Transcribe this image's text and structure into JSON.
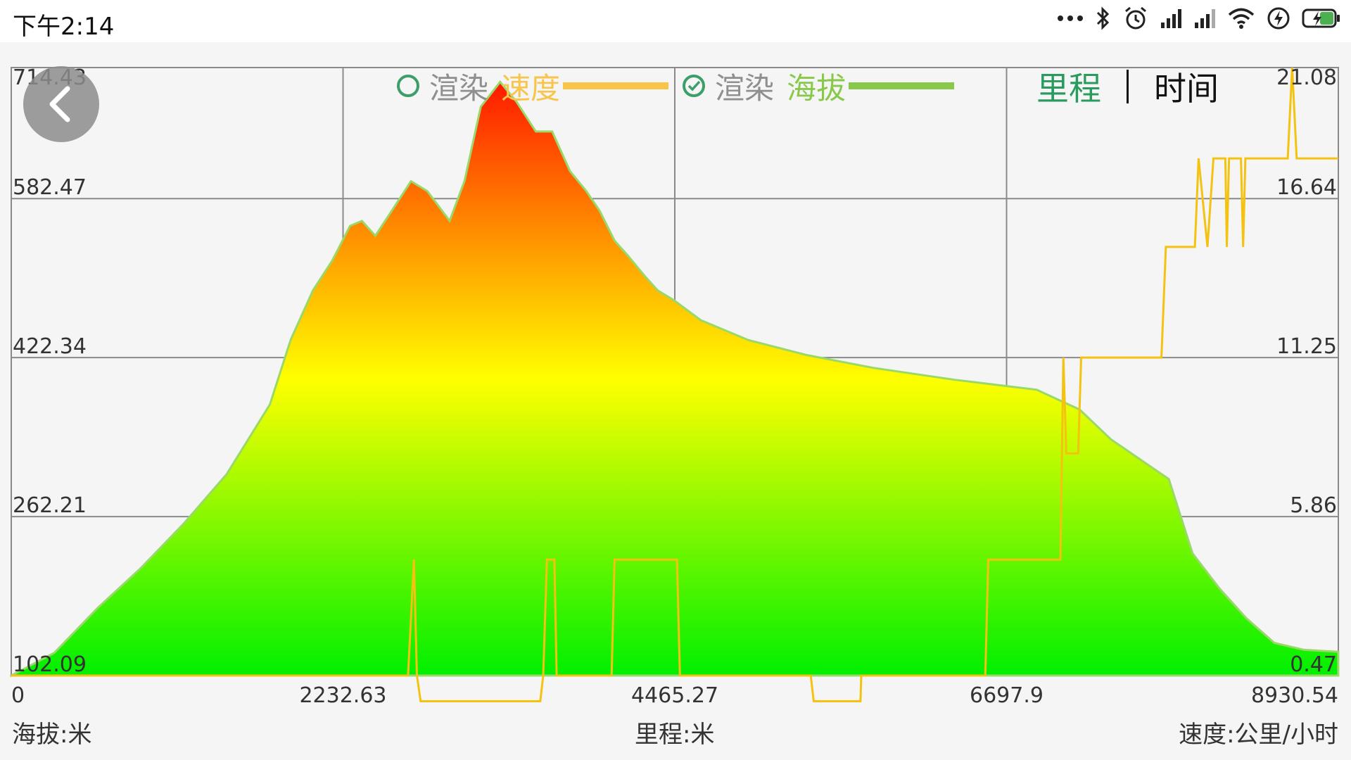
{
  "status_bar": {
    "time": "下午2:14",
    "icons": [
      "more-dots-icon",
      "bluetooth-icon",
      "alarm-icon",
      "signal-icon",
      "signal-icon-2",
      "wifi-icon",
      "charging-icon",
      "battery-icon"
    ]
  },
  "legend": {
    "speed": {
      "render_label": "渲染",
      "name": "速度",
      "checked": false,
      "color": "#f8c44a"
    },
    "altitude": {
      "render_label": "渲染",
      "name": "海拔",
      "checked": true,
      "color": "#88c84a"
    }
  },
  "toggle": {
    "distance": "里程",
    "time": "时间",
    "active": "distance"
  },
  "units": {
    "left": "海拔:米",
    "center": "里程:米",
    "right": "速度:公里/小时"
  },
  "colors": {
    "active_green": "#2a9b5f",
    "speed_line": "#f4c211",
    "gradient_top": "#ff1a00",
    "gradient_mid": "#ffff00",
    "gradient_bottom": "#00f000"
  },
  "chart_data": {
    "type": "area",
    "x_ticks": [
      "0",
      "2232.63",
      "4465.27",
      "6697.9",
      "8930.54"
    ],
    "y_left_ticks": [
      "714.43",
      "582.47",
      "422.34",
      "262.21",
      "102.09"
    ],
    "y_right_ticks": [
      "21.08",
      "16.64",
      "11.25",
      "5.86",
      "0.47"
    ],
    "xlim": [
      0,
      8930.54
    ],
    "ylim_left": [
      102.09,
      714.43
    ],
    "ylim_right": [
      0.47,
      21.08
    ],
    "grid": true,
    "series": [
      {
        "name": "海拔",
        "axis": "left",
        "x": [
          0,
          290,
          580,
          870,
          1160,
          1450,
          1740,
          1880,
          2030,
          2160,
          2280,
          2360,
          2450,
          2560,
          2690,
          2800,
          2950,
          3050,
          3160,
          3290,
          3400,
          3530,
          3640,
          3760,
          3870,
          3960,
          4060,
          4150,
          4260,
          4350,
          4460,
          4640,
          4960,
          5350,
          5800,
          6350,
          6900,
          7190,
          7400,
          7790,
          7950,
          8130,
          8310,
          8500,
          8700,
          8930
        ],
        "y": [
          102,
          125,
          170,
          210,
          255,
          305,
          375,
          440,
          490,
          520,
          555,
          560,
          545,
          570,
          600,
          590,
          560,
          600,
          675,
          700,
          680,
          650,
          650,
          610,
          590,
          570,
          540,
          525,
          505,
          490,
          480,
          460,
          440,
          425,
          412,
          400,
          390,
          370,
          340,
          300,
          225,
          190,
          160,
          135,
          128,
          126
        ]
      },
      {
        "name": "速度",
        "axis": "right",
        "x": [
          0,
          2670,
          2710,
          2730,
          2755,
          3560,
          3580,
          3605,
          3655,
          3670,
          3695,
          4040,
          4060,
          4075,
          4470,
          4480,
          4500,
          5370,
          5380,
          5400,
          5715,
          5720,
          5735,
          6555,
          6575,
          6610,
          7060,
          7080,
          7100,
          7180,
          7200,
          7215,
          7410,
          7425,
          7440,
          7740,
          7770,
          7800,
          7965,
          7990,
          8050,
          8090,
          8105,
          8170,
          8180,
          8195,
          8275,
          8290,
          8305,
          8340,
          8345,
          8350,
          8360,
          8590,
          8620,
          8650,
          8930
        ],
        "y": [
          0.47,
          0.47,
          4.4,
          0.47,
          -0.4,
          -0.4,
          0.47,
          4.4,
          4.4,
          0.47,
          0.47,
          0.47,
          4.4,
          4.4,
          4.4,
          4.4,
          0.47,
          0.47,
          0.47,
          -0.4,
          -0.4,
          0.47,
          0.47,
          0.47,
          4.4,
          4.4,
          4.4,
          11.25,
          8.0,
          8.0,
          11.25,
          11.25,
          11.25,
          11.25,
          11.25,
          11.25,
          15.0,
          15.0,
          15.0,
          18.0,
          15.0,
          18.0,
          18.0,
          18.0,
          15.0,
          18.0,
          18.0,
          15.0,
          18.0,
          18.0,
          18.0,
          18.0,
          18.0,
          18.0,
          21.08,
          18.0,
          18.0
        ]
      }
    ]
  }
}
